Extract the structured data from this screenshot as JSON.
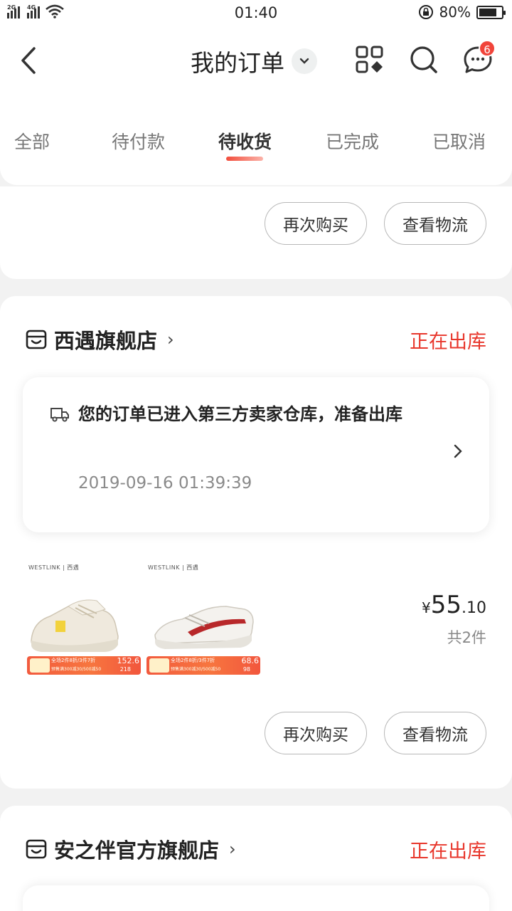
{
  "status_bar": {
    "signal1_label": "2G",
    "signal2_label": "4G",
    "time": "01:40",
    "battery_pct": "80%",
    "battery_level": 0.8
  },
  "header": {
    "title": "我的订单",
    "message_badge": "6"
  },
  "tabs": [
    {
      "label": "全部",
      "active": false
    },
    {
      "label": "待付款",
      "active": false
    },
    {
      "label": "待收货",
      "active": true
    },
    {
      "label": "已完成",
      "active": false
    },
    {
      "label": "已取消",
      "active": false
    }
  ],
  "cards": [
    {
      "buttons": [
        "再次购买",
        "查看物流"
      ]
    },
    {
      "store_name": "西遇旗舰店",
      "store_chevron": "›",
      "status": "正在出库",
      "logistics": {
        "message": "您的订单已进入第三方卖家仓库，准备出库",
        "time": "2019-09-16 01:39:39"
      },
      "products": [
        {
          "brand": "WESTLINK | 西遇",
          "banner_line1": "全场2件8折/3件7折",
          "banner_line2": "预售满300减30/500减50",
          "price_big": "152.6",
          "price_small": "218",
          "shoe_color": "yellow"
        },
        {
          "brand": "WESTLINK | 西遇",
          "banner_line1": "全场2件8折/3件7折",
          "banner_line2": "预售满300减30/500减50",
          "price_big": "68.6",
          "price_small": "98",
          "shoe_color": "red"
        }
      ],
      "total": {
        "currency": "¥",
        "integer": "55",
        "decimal": ".10",
        "qty": "共2件"
      },
      "buttons": [
        "再次购买",
        "查看物流"
      ]
    },
    {
      "store_name": "安之伴官方旗舰店",
      "store_chevron": "›",
      "status": "正在出库"
    }
  ],
  "colors": {
    "accent_red": "#e8372c",
    "badge_red": "#f1443a",
    "background": "#f2f2f2"
  },
  "icons": [
    "back-arrow-icon",
    "chevron-down-icon",
    "grid-menu-icon",
    "search-icon",
    "message-icon",
    "store-icon",
    "truck-icon",
    "chevron-right-icon"
  ]
}
